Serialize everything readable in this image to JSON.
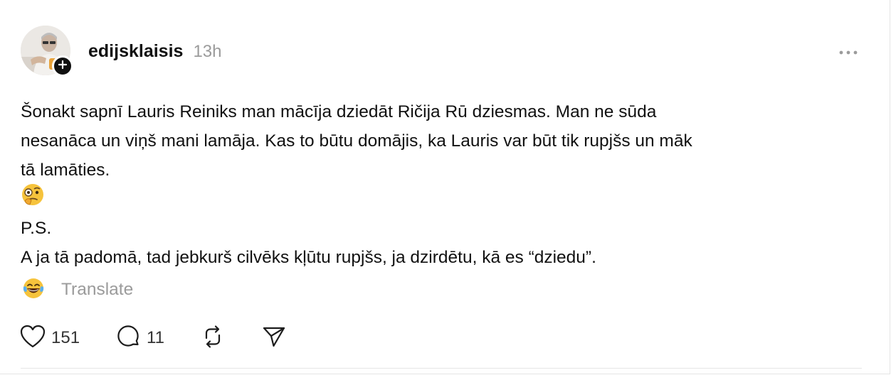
{
  "post": {
    "author": "edijsklaisis",
    "time": "13h",
    "body_lines": [
      "Šonakt sapnī Lauris Reiniks man mācīja dziedāt Ričija Rū dziesmas. Man ne sūda",
      "nesanāca un viņš mani lamāja. Kas to būtu domājis, ka Lauris var būt tik rupjšs un māk",
      "tā lamāties."
    ],
    "ps_label": "P.S.",
    "ps_text": "A ja tā padomā, tad jebkurš cilvēks kļūtu rupjšs, ja dzirdētu, kā es “dziedu”.",
    "translate_label": "Translate"
  },
  "actions": {
    "likes": "151",
    "replies": "11"
  },
  "colors": {
    "text": "#111111",
    "muted": "#9b9b9b",
    "icon": "#1c1c1c",
    "divider": "#e6e6e6"
  },
  "icons": [
    "follow-plus-icon",
    "more-options-icon",
    "face-with-monocle-emoji",
    "laughing-tears-emoji",
    "heart-icon",
    "comment-icon",
    "repost-icon",
    "share-send-icon"
  ]
}
